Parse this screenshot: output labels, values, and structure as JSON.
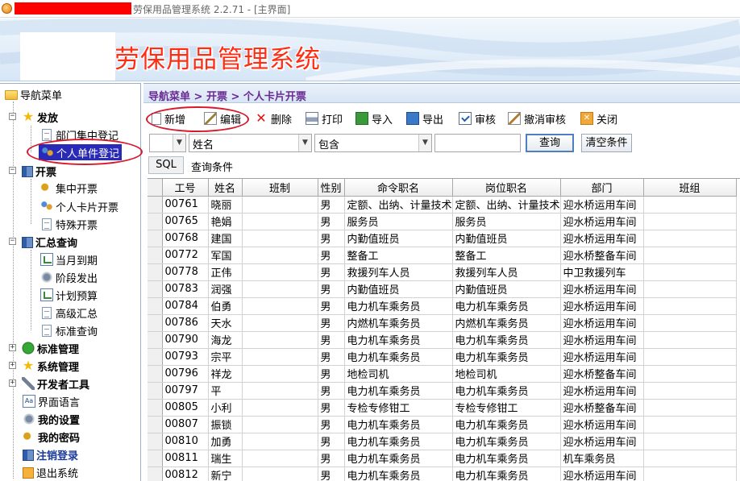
{
  "window": {
    "title": "劳保用品管理系统 2.2.71 - [主界面]"
  },
  "banner": {
    "title": "劳保用品管理系统"
  },
  "sidebar": {
    "root_label": "导航菜单",
    "groups": {
      "fafang": {
        "label": "发放",
        "items": [
          "部门集中登记",
          "个人单件登记"
        ]
      },
      "kaipiao": {
        "label": "开票",
        "items": [
          "集中开票",
          "个人卡片开票",
          "特殊开票"
        ]
      },
      "huizong": {
        "label": "汇总查询",
        "items": [
          "当月到期",
          "阶段发出",
          "计划预算",
          "高级汇总",
          "标准查询"
        ]
      },
      "biaozhun": {
        "label": "标准管理"
      },
      "xitong": {
        "label": "系统管理"
      },
      "kaifa": {
        "label": "开发者工具"
      }
    },
    "bottom_items": {
      "language": "界面语言",
      "settings": "我的设置",
      "password": "我的密码",
      "logout": "注销登录",
      "exit": "退出系统"
    }
  },
  "main": {
    "breadcrumb": "导航菜单 > 开票 > 个人卡片开票",
    "toolbar": {
      "new": "新增",
      "edit": "编辑",
      "delete": "删除",
      "print": "打印",
      "import": "导入",
      "export": "导出",
      "audit": "审核",
      "unaudit": "撤消审核",
      "close": "关闭"
    },
    "filter": {
      "field_value": "姓名",
      "operator_value": "包含",
      "text_value": "",
      "query_label": "查询",
      "clear_label": "清空条件",
      "sql_label": "SQL",
      "condition_label": "查询条件"
    },
    "grid": {
      "columns": [
        "工号",
        "姓名",
        "班制",
        "性别",
        "命令职名",
        "岗位职名",
        "部门",
        "班组"
      ],
      "rows": [
        [
          "00761",
          "晓丽",
          "",
          "男",
          "定额、出纳、计量技术",
          "定额、出纳、计量技术",
          "迎水桥运用车间",
          ""
        ],
        [
          "00765",
          "艳娟",
          "",
          "男",
          "服务员",
          "服务员",
          "迎水桥运用车间",
          ""
        ],
        [
          "00768",
          "建国",
          "",
          "男",
          "内勤值班员",
          "内勤值班员",
          "迎水桥运用车间",
          ""
        ],
        [
          "00772",
          "军国",
          "",
          "男",
          "整备工",
          "整备工",
          "迎水桥整备车间",
          ""
        ],
        [
          "00778",
          "正伟",
          "",
          "男",
          "救援列车人员",
          "救援列车人员",
          "中卫救援列车",
          ""
        ],
        [
          "00783",
          "润强",
          "",
          "男",
          "内勤值班员",
          "内勤值班员",
          "迎水桥运用车间",
          ""
        ],
        [
          "00784",
          "伯勇",
          "",
          "男",
          "电力机车乘务员",
          "电力机车乘务员",
          "迎水桥运用车间",
          ""
        ],
        [
          "00786",
          "天水",
          "",
          "男",
          "内燃机车乘务员",
          "内燃机车乘务员",
          "迎水桥运用车间",
          ""
        ],
        [
          "00790",
          "海龙",
          "",
          "男",
          "电力机车乘务员",
          "电力机车乘务员",
          "迎水桥运用车间",
          ""
        ],
        [
          "00793",
          "宗平",
          "",
          "男",
          "电力机车乘务员",
          "电力机车乘务员",
          "迎水桥运用车间",
          ""
        ],
        [
          "00796",
          "祥龙",
          "",
          "男",
          "地检司机",
          "地检司机",
          "迎水桥整备车间",
          ""
        ],
        [
          "00797",
          "平",
          "",
          "男",
          "电力机车乘务员",
          "电力机车乘务员",
          "迎水桥运用车间",
          ""
        ],
        [
          "00805",
          "小利",
          "",
          "男",
          "专检专修钳工",
          "专检专修钳工",
          "迎水桥整备车间",
          ""
        ],
        [
          "00807",
          "振锁",
          "",
          "男",
          "电力机车乘务员",
          "电力机车乘务员",
          "迎水桥运用车间",
          ""
        ],
        [
          "00810",
          "加勇",
          "",
          "男",
          "电力机车乘务员",
          "电力机车乘务员",
          "迎水桥运用车间",
          ""
        ],
        [
          "00811",
          "瑞生",
          "",
          "男",
          "电力机车乘务员",
          "电力机车乘务员",
          "机车乘务员",
          ""
        ],
        [
          "00812",
          "新宁",
          "",
          "男",
          "电力机车乘务员",
          "电力机车乘务员",
          "迎水桥运用车间",
          ""
        ]
      ]
    }
  }
}
